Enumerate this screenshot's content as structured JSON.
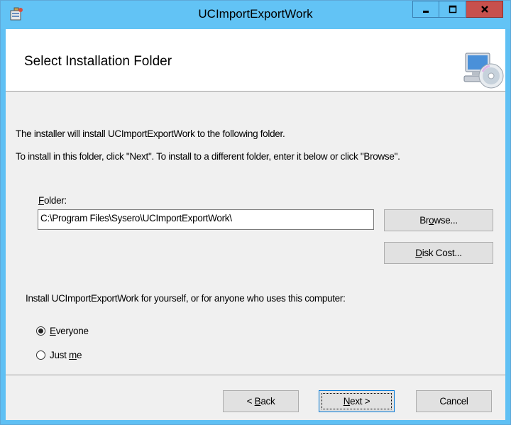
{
  "window": {
    "title": "UCImportExportWork"
  },
  "header": {
    "title": "Select Installation Folder"
  },
  "content": {
    "intro_line1": "The installer will install UCImportExportWork to the following folder.",
    "intro_line2": "To install in this folder, click \"Next\". To install to a different folder, enter it below or click \"Browse\".",
    "folder_label_prefix": "F",
    "folder_label_rest": "older:",
    "folder_value": "C:\\Program Files\\Sysero\\UCImportExportWork\\",
    "browse_label": {
      "pre": "Br",
      "key": "o",
      "post": "wse..."
    },
    "disk_cost_label": {
      "pre": "",
      "key": "D",
      "post": "isk Cost..."
    },
    "install_for_text": "Install UCImportExportWork for yourself, or for anyone who uses this computer:",
    "options": [
      {
        "pre": "",
        "key": "E",
        "post": "veryone",
        "selected": true
      },
      {
        "pre": "Just ",
        "key": "m",
        "post": "e",
        "selected": false
      }
    ]
  },
  "footer": {
    "back": {
      "pre": "< ",
      "key": "B",
      "post": "ack"
    },
    "next": {
      "pre": "",
      "key": "N",
      "post": "ext >"
    },
    "cancel": "Cancel"
  },
  "colors": {
    "titlebar": "#62c3f5",
    "close": "#c7504d",
    "dialog_bg": "#f0f0f0"
  }
}
